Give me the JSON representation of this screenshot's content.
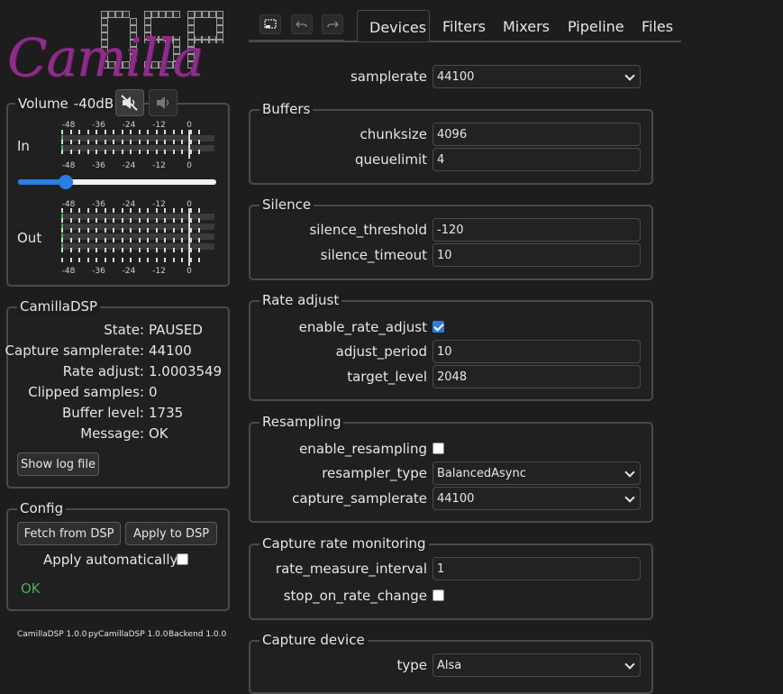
{
  "logo": {
    "script_text": "Camilla",
    "grid_text": "DSP"
  },
  "volume": {
    "label": "Volume",
    "value": "-40dB",
    "slider_fraction": 0.24
  },
  "meters": {
    "in_label": "In",
    "out_label": "Out",
    "scale": [
      "-48",
      "-36",
      "-24",
      "-12",
      "0"
    ]
  },
  "status": {
    "legend": "CamillaDSP",
    "rows": [
      {
        "k": "State:",
        "v": "PAUSED"
      },
      {
        "k": "Capture samplerate:",
        "v": "44100"
      },
      {
        "k": "Rate adjust:",
        "v": "1.0003549"
      },
      {
        "k": "Clipped samples:",
        "v": "0"
      },
      {
        "k": "Buffer level:",
        "v": "1735"
      },
      {
        "k": "Message:",
        "v": "OK"
      }
    ],
    "show_log": "Show log file"
  },
  "config": {
    "legend": "Config",
    "fetch": "Fetch from DSP",
    "apply": "Apply to DSP",
    "apply_auto": "Apply automatically",
    "status": "OK",
    "status_color": "#4caf50"
  },
  "versions": {
    "camilladsp": "CamillaDSP 1.0.0",
    "pycamilladsp": "pyCamillaDSP 1.0.0",
    "backend": "Backend 1.0.0"
  },
  "tabs": [
    "Devices",
    "Filters",
    "Mixers",
    "Pipeline",
    "Files"
  ],
  "active_tab": "Devices",
  "devices": {
    "samplerate": {
      "label": "samplerate",
      "value": "44100"
    },
    "buffers": {
      "legend": "Buffers",
      "chunksize": {
        "label": "chunksize",
        "value": "4096"
      },
      "queuelimit": {
        "label": "queuelimit",
        "value": "4"
      }
    },
    "silence": {
      "legend": "Silence",
      "threshold": {
        "label": "silence_threshold",
        "value": "-120"
      },
      "timeout": {
        "label": "silence_timeout",
        "value": "10"
      }
    },
    "rate_adjust": {
      "legend": "Rate adjust",
      "enable": {
        "label": "enable_rate_adjust",
        "checked": true
      },
      "period": {
        "label": "adjust_period",
        "value": "10"
      },
      "target": {
        "label": "target_level",
        "value": "2048"
      }
    },
    "resampling": {
      "legend": "Resampling",
      "enable": {
        "label": "enable_resampling",
        "checked": false
      },
      "type": {
        "label": "resampler_type",
        "value": "BalancedAsync"
      },
      "capture_sr": {
        "label": "capture_samplerate",
        "value": "44100"
      }
    },
    "capture_rate": {
      "legend": "Capture rate monitoring",
      "interval": {
        "label": "rate_measure_interval",
        "value": "1"
      },
      "stop": {
        "label": "stop_on_rate_change",
        "checked": false
      }
    },
    "capture_device": {
      "legend": "Capture device",
      "type": {
        "label": "type",
        "value": "Alsa"
      }
    }
  },
  "icons": {
    "mute": "speaker-muted-icon",
    "speaker": "speaker-icon",
    "undo": "undo-icon",
    "redo": "redo-icon",
    "screen": "screen-icon"
  },
  "colors": {
    "accent": "#2a7de1",
    "logo": "#8f2c8a",
    "ok": "#4caf50"
  }
}
